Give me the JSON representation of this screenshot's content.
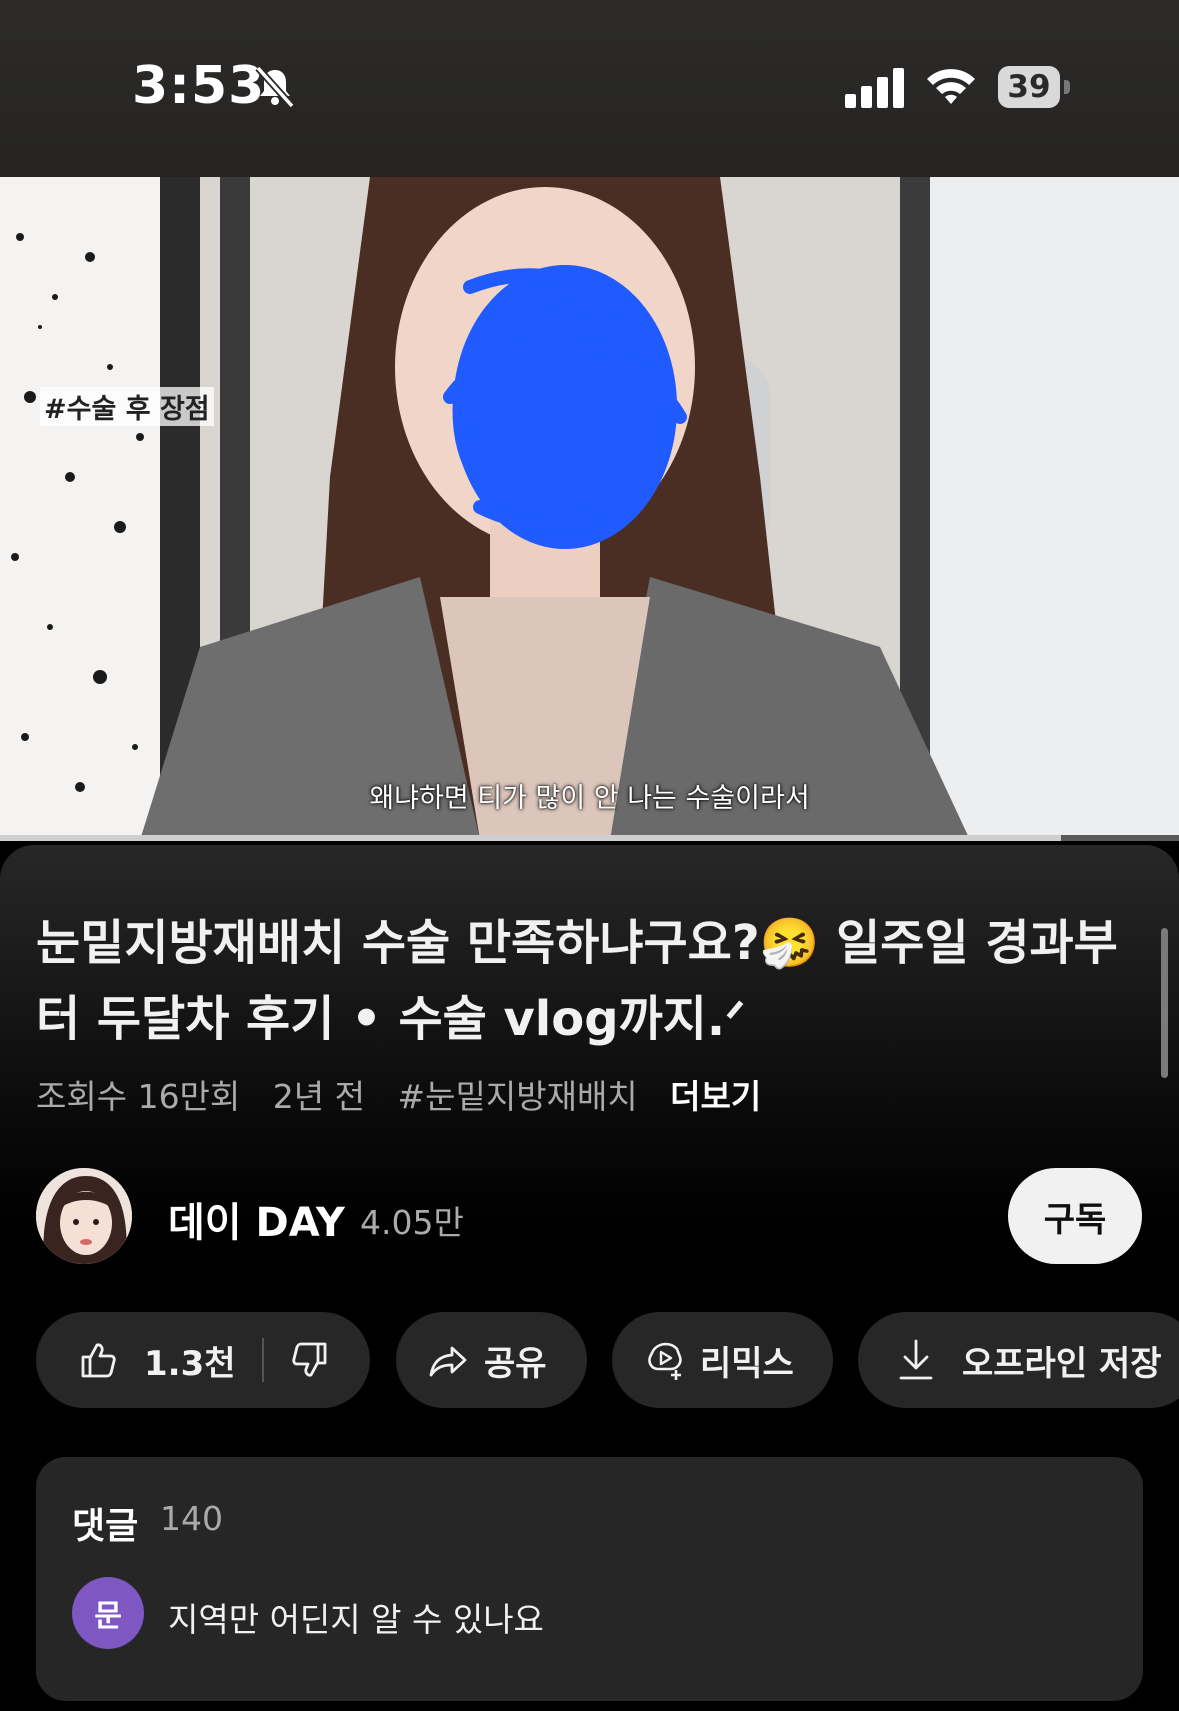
{
  "status_bar": {
    "time": "3:53",
    "battery": "39",
    "icons": [
      "bell-slash-icon",
      "signal-icon",
      "wifi-icon",
      "battery-icon"
    ]
  },
  "video": {
    "overlay_hashtag": "#수술 후 장점",
    "subtitle": "왜냐하면 티가 많이 안 나는 수술이라서",
    "progress_percent": 90
  },
  "info": {
    "title": "눈밑지방재배치 수술 만족하냐구요?🤧 일주일 경과부터 두달차 후기 • 수술 vlog까지.ᐟ",
    "views": "조회수 16만회",
    "age": "2년 전",
    "hashtag": "#눈밑지방재배치",
    "more": "더보기"
  },
  "channel": {
    "name": "데이 DAY",
    "subscribers": "4.05만",
    "subscribe_label": "구독"
  },
  "actions": {
    "like_count": "1.3천",
    "share_label": "공유",
    "remix_label": "리믹스",
    "save_label": "오프라인 저장"
  },
  "comments": {
    "label": "댓글",
    "count": "140",
    "preview_avatar": "문",
    "preview_text": "지역만 어딘지 알 수 있나요"
  }
}
